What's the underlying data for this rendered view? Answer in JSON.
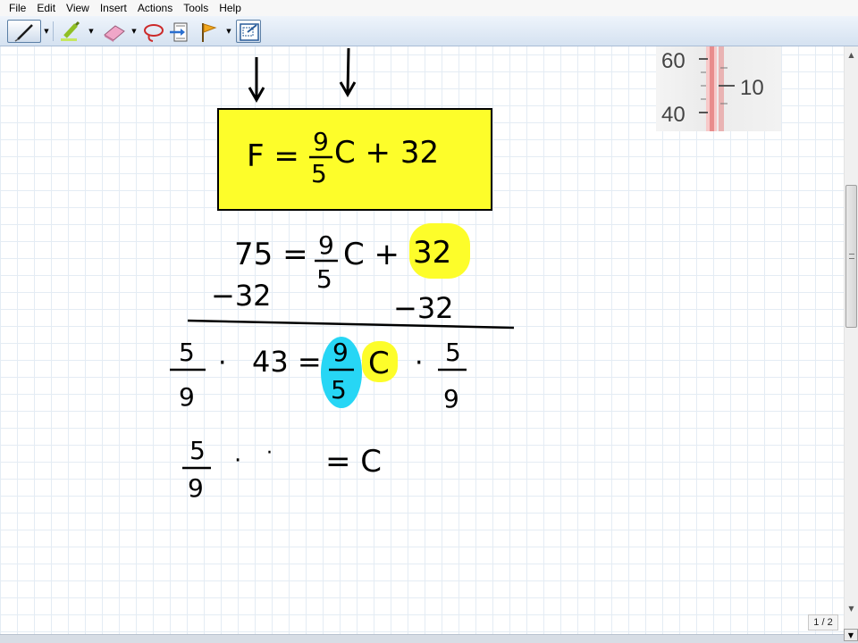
{
  "menu": [
    "File",
    "Edit",
    "View",
    "Insert",
    "Actions",
    "Tools",
    "Help"
  ],
  "toolbar": {
    "icons": [
      "pen-icon",
      "highlighter-icon",
      "eraser-icon",
      "lasso-icon",
      "insert-space-icon",
      "flag-icon",
      "screenshot-icon"
    ],
    "accent": "#5b7fa6"
  },
  "thermometer": {
    "label_60": "60",
    "label_40": "40",
    "label_10": "10"
  },
  "equation_box": {
    "lhs": "F =",
    "frac_num": "9",
    "frac_den": "5",
    "rhs": "C + 32",
    "fill": "#fdfd2a"
  },
  "steps": {
    "line1": {
      "lhs": "75 =",
      "num": "9",
      "den": "5",
      "mid": "C +",
      "highlight": "32"
    },
    "line2": {
      "left": "−32",
      "right": "−32"
    },
    "line3": {
      "frac_num": "5",
      "frac_den": "9",
      "dot": "·",
      "value": "43 =",
      "num": "9",
      "den": "5",
      "c": "C",
      "dot2": "·",
      "frac2_num": "5",
      "frac2_den": "9"
    },
    "line4": {
      "frac_num": "5",
      "frac_den": "9",
      "dot": "·",
      "dot2": "·",
      "eq": "= C"
    },
    "highlight_yellow": "#fdfd2a",
    "highlight_cyan": "#27d6f5"
  },
  "page_indicator": "1 / 2"
}
